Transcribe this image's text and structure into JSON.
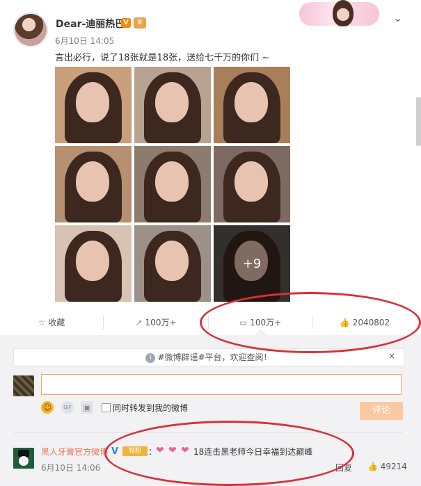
{
  "post": {
    "username": "Dear-迪丽热巴",
    "verified_badge": "V",
    "date": "6月10日 14:05",
    "text": "言出必行，说了18张就是18张，送给七千万的你们 ~",
    "more_photos_label": "+9",
    "menu_icon": "chevron-down-icon"
  },
  "actions": {
    "favorite_label": "收藏",
    "repost_count": "100万+",
    "comment_count": "100万+",
    "like_count": "2040802"
  },
  "comment_box": {
    "notice": "#微博辟谣#平台，欢迎查阅！",
    "notice_close": "×",
    "share_label": "同时转发到我的微博",
    "submit_label": "评论",
    "gif_label": "GIF"
  },
  "comment": {
    "author": "黑人牙膏官方微博",
    "verified": "V",
    "fan_badge": "铁粉",
    "colon": "：",
    "text": "18连击黑老师今日幸福到达巅峰",
    "time": "6月10日 14:06",
    "reply_label": "回复",
    "like_count": "49214"
  },
  "colors": {
    "accent_orange": "#eb7350",
    "annotation_red": "#d9303a"
  }
}
